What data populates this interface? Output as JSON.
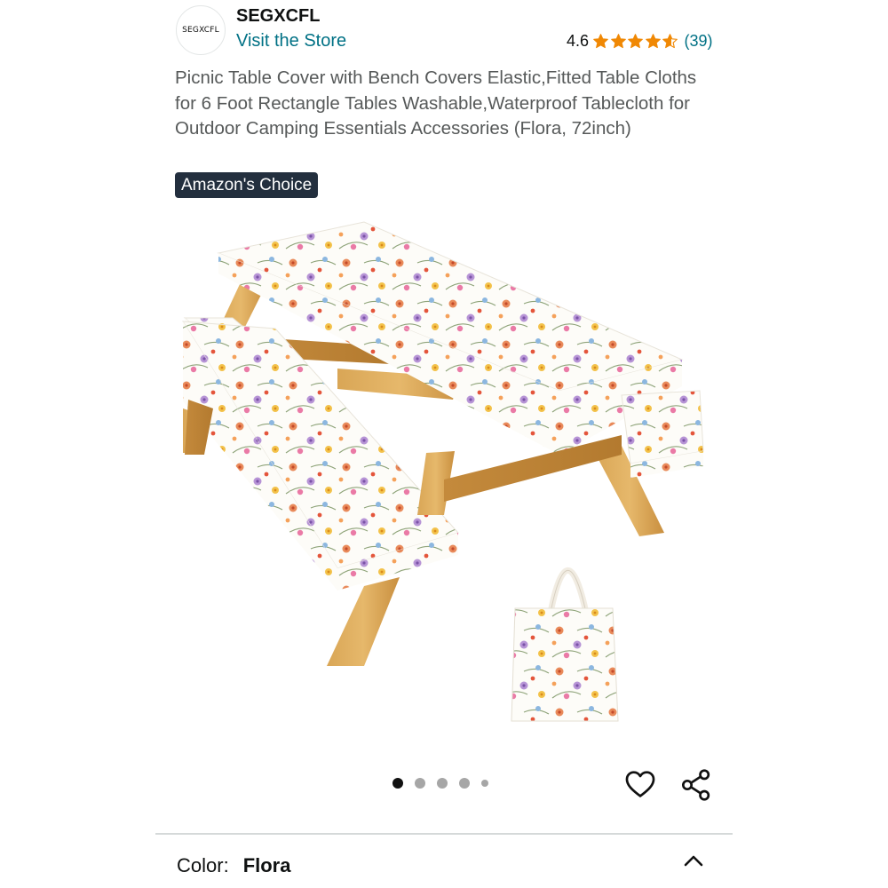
{
  "store": {
    "logo_text": "SEGXCFL",
    "brand_name": "SEGXCFL",
    "visit_store_label": "Visit the Store"
  },
  "rating": {
    "score": "4.6",
    "stars_value": 4.6,
    "stars_max": 5,
    "count": "(39)",
    "star_color": "#f08804"
  },
  "product": {
    "title": "Picnic Table Cover with Bench Covers Elastic,Fitted Table Cloths for 6 Foot Rectangle Tables Washable,Waterproof Tablecloth for Outdoor Camping Essentials Accessories (Flora, 72inch)",
    "badge": "Amazon's Choice",
    "badge_color": "#232f3e"
  },
  "carousel": {
    "total_images": 5,
    "active_index": 0
  },
  "actions": {
    "wishlist_icon": "heart-icon",
    "share_icon": "share-icon"
  },
  "variation": {
    "label": "Color:",
    "value": "Flora",
    "toggle_icon": "chevron-up-icon"
  },
  "colors": {
    "link": "#007185",
    "text": "#0f1111",
    "muted_text": "#565959"
  }
}
